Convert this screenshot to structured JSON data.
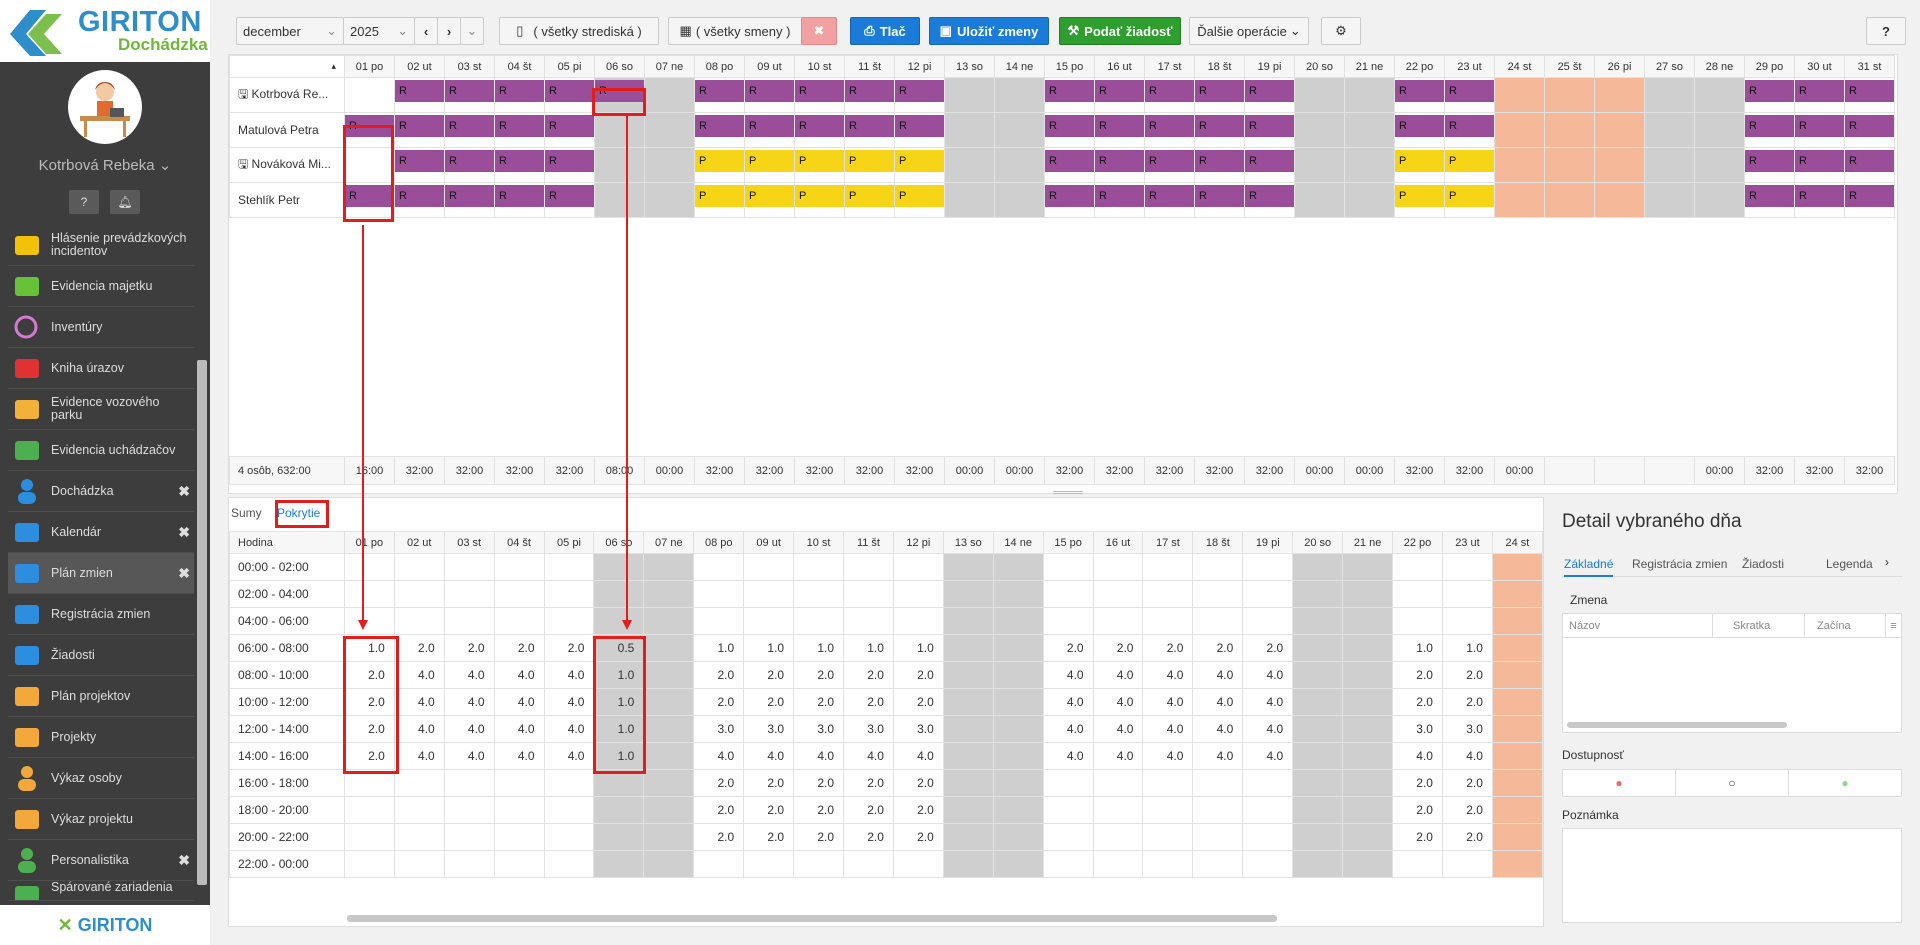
{
  "brand": {
    "name": "GIRITON",
    "sub": "Dochádzka",
    "footer": "GIRITON"
  },
  "user": {
    "name": "Kotrbová Rebeka"
  },
  "menu": [
    {
      "label": "Hlásenie prevádzkových incidentov",
      "icon": "megaphone-icon",
      "color": "#f2c10a",
      "close": false
    },
    {
      "label": "Evidencia majetku",
      "icon": "box-icon",
      "color": "#67c23a",
      "close": false
    },
    {
      "label": "Inventúry",
      "icon": "circle-icon",
      "color": "#d27bd2",
      "close": false
    },
    {
      "label": "Kniha úrazov",
      "icon": "ambulance-icon",
      "color": "#e03232",
      "close": false
    },
    {
      "label": "Evidence vozového parku",
      "icon": "car-icon",
      "color": "#f2b23a",
      "close": false
    },
    {
      "label": "Evidencia uchádzačov",
      "icon": "user-plus-icon",
      "color": "#4caf50",
      "close": false
    },
    {
      "label": "Dochádzka",
      "icon": "user-icon",
      "color": "#2d8ee0",
      "close": true
    },
    {
      "label": "Kalendár",
      "icon": "calendar-icon",
      "color": "#2d8ee0",
      "close": true
    },
    {
      "label": "Plán zmien",
      "icon": "calendar-grid-icon",
      "color": "#2d8ee0",
      "close": true
    },
    {
      "label": "Registrácia zmien",
      "icon": "calendar-check-icon",
      "color": "#2d8ee0",
      "close": false
    },
    {
      "label": "Žiadosti",
      "icon": "gavel-icon",
      "color": "#2d8ee0",
      "close": false
    },
    {
      "label": "Plán projektov",
      "icon": "calendar-grid-icon",
      "color": "#f2a83a",
      "close": false
    },
    {
      "label": "Projekty",
      "icon": "calendar-icon",
      "color": "#f2a83a",
      "close": false
    },
    {
      "label": "Výkaz osoby",
      "icon": "user-icon",
      "color": "#f2a83a",
      "close": false
    },
    {
      "label": "Výkaz projektu",
      "icon": "users-icon",
      "color": "#f2a83a",
      "close": false
    },
    {
      "label": "Personalistika",
      "icon": "person-icon",
      "color": "#4caf50",
      "close": true
    },
    {
      "label": "Spárované zariadenia",
      "icon": "device-icon",
      "color": "#4caf50",
      "close": false
    }
  ],
  "toolbar": {
    "month": "december",
    "year": "2025",
    "centers": "( všetky strediská )",
    "shifts": "( všetky smeny )",
    "print": "Tlač",
    "save": "Uložiť zmeny",
    "request": "Podať žiadosť",
    "more": "Ďalšie operácie",
    "help": "?"
  },
  "days": [
    "01 po",
    "02 ut",
    "03 st",
    "04 št",
    "05 pi",
    "06 so",
    "07 ne",
    "08 po",
    "09 ut",
    "10 st",
    "11 št",
    "12 pi",
    "13 so",
    "14 ne",
    "15 po",
    "16 ut",
    "17 st",
    "18 št",
    "19 pi",
    "20 so",
    "21 ne",
    "22 po",
    "23 ut",
    "24 st",
    "25 št",
    "26 pi",
    "27 so",
    "28 ne",
    "29 po",
    "30 ut",
    "31 st"
  ],
  "employees": [
    {
      "name": "Kotrbová Re...",
      "icon": true,
      "shifts": [
        "",
        "R",
        "R",
        "R",
        "R",
        "R",
        "",
        "R",
        "R",
        "R",
        "R",
        "R",
        "",
        "",
        "R",
        "R",
        "R",
        "R",
        "R",
        "",
        "",
        "R",
        "R",
        "",
        "",
        "",
        "",
        "",
        "R",
        "R",
        "R"
      ]
    },
    {
      "name": "Matulová Petra",
      "icon": false,
      "shifts": [
        "R",
        "R",
        "R",
        "R",
        "R",
        "",
        "",
        "R",
        "R",
        "R",
        "R",
        "R",
        "",
        "",
        "R",
        "R",
        "R",
        "R",
        "R",
        "",
        "",
        "R",
        "R",
        "",
        "",
        "",
        "",
        "",
        "R",
        "R",
        "R"
      ]
    },
    {
      "name": "Nováková Mi...",
      "icon": true,
      "shifts": [
        "",
        "R",
        "R",
        "R",
        "R",
        "",
        "",
        "P",
        "P",
        "P",
        "P",
        "P",
        "",
        "",
        "R",
        "R",
        "R",
        "R",
        "R",
        "",
        "",
        "P",
        "P",
        "",
        "",
        "",
        "",
        "",
        "R",
        "R",
        "R"
      ]
    },
    {
      "name": "Stehlík Petr",
      "icon": false,
      "shifts": [
        "R",
        "R",
        "R",
        "R",
        "R",
        "",
        "",
        "P",
        "P",
        "P",
        "P",
        "P",
        "",
        "",
        "R",
        "R",
        "R",
        "R",
        "R",
        "",
        "",
        "P",
        "P",
        "",
        "",
        "",
        "",
        "",
        "R",
        "R",
        "R"
      ]
    }
  ],
  "summary": {
    "label": "4 osôb, 632:00",
    "totals": [
      "16:00",
      "32:00",
      "32:00",
      "32:00",
      "32:00",
      "08:00",
      "00:00",
      "32:00",
      "32:00",
      "32:00",
      "32:00",
      "32:00",
      "00:00",
      "00:00",
      "32:00",
      "32:00",
      "32:00",
      "32:00",
      "32:00",
      "00:00",
      "00:00",
      "32:00",
      "32:00",
      "00:00",
      "",
      "",
      "",
      "00:00",
      "32:00",
      "32:00",
      "32:00"
    ]
  },
  "coverage_tabs": {
    "sums": "Sumy",
    "coverage": "Pokrytie"
  },
  "coverage": {
    "hour_header": "Hodina",
    "days": [
      "01 po",
      "02 ut",
      "03 st",
      "04 št",
      "05 pi",
      "06 so",
      "07 ne",
      "08 po",
      "09 ut",
      "10 st",
      "11 št",
      "12 pi",
      "13 so",
      "14 ne",
      "15 po",
      "16 ut",
      "17 st",
      "18 št",
      "19 pi",
      "20 so",
      "21 ne",
      "22 po",
      "23 ut",
      "24 st"
    ],
    "rows": [
      {
        "hour": "00:00 - 02:00",
        "v": [
          "",
          "",
          "",
          "",
          "",
          "",
          "",
          "",
          "",
          "",
          "",
          "",
          "",
          "",
          "",
          "",
          "",
          "",
          "",
          "",
          "",
          "",
          "",
          ""
        ]
      },
      {
        "hour": "02:00 - 04:00",
        "v": [
          "",
          "",
          "",
          "",
          "",
          "",
          "",
          "",
          "",
          "",
          "",
          "",
          "",
          "",
          "",
          "",
          "",
          "",
          "",
          "",
          "",
          "",
          "",
          ""
        ]
      },
      {
        "hour": "04:00 - 06:00",
        "v": [
          "",
          "",
          "",
          "",
          "",
          "",
          "",
          "",
          "",
          "",
          "",
          "",
          "",
          "",
          "",
          "",
          "",
          "",
          "",
          "",
          "",
          "",
          "",
          ""
        ]
      },
      {
        "hour": "06:00 - 08:00",
        "v": [
          "1.0",
          "2.0",
          "2.0",
          "2.0",
          "2.0",
          "0.5",
          "",
          "1.0",
          "1.0",
          "1.0",
          "1.0",
          "1.0",
          "",
          "",
          "2.0",
          "2.0",
          "2.0",
          "2.0",
          "2.0",
          "",
          "",
          "1.0",
          "1.0",
          ""
        ]
      },
      {
        "hour": "08:00 - 10:00",
        "v": [
          "2.0",
          "4.0",
          "4.0",
          "4.0",
          "4.0",
          "1.0",
          "",
          "2.0",
          "2.0",
          "2.0",
          "2.0",
          "2.0",
          "",
          "",
          "4.0",
          "4.0",
          "4.0",
          "4.0",
          "4.0",
          "",
          "",
          "2.0",
          "2.0",
          ""
        ]
      },
      {
        "hour": "10:00 - 12:00",
        "v": [
          "2.0",
          "4.0",
          "4.0",
          "4.0",
          "4.0",
          "1.0",
          "",
          "2.0",
          "2.0",
          "2.0",
          "2.0",
          "2.0",
          "",
          "",
          "4.0",
          "4.0",
          "4.0",
          "4.0",
          "4.0",
          "",
          "",
          "2.0",
          "2.0",
          ""
        ]
      },
      {
        "hour": "12:00 - 14:00",
        "v": [
          "2.0",
          "4.0",
          "4.0",
          "4.0",
          "4.0",
          "1.0",
          "",
          "3.0",
          "3.0",
          "3.0",
          "3.0",
          "3.0",
          "",
          "",
          "4.0",
          "4.0",
          "4.0",
          "4.0",
          "4.0",
          "",
          "",
          "3.0",
          "3.0",
          ""
        ]
      },
      {
        "hour": "14:00 - 16:00",
        "v": [
          "2.0",
          "4.0",
          "4.0",
          "4.0",
          "4.0",
          "1.0",
          "",
          "4.0",
          "4.0",
          "4.0",
          "4.0",
          "4.0",
          "",
          "",
          "4.0",
          "4.0",
          "4.0",
          "4.0",
          "4.0",
          "",
          "",
          "4.0",
          "4.0",
          ""
        ]
      },
      {
        "hour": "16:00 - 18:00",
        "v": [
          "",
          "",
          "",
          "",
          "",
          "",
          "",
          "2.0",
          "2.0",
          "2.0",
          "2.0",
          "2.0",
          "",
          "",
          "",
          "",
          "",
          "",
          "",
          "",
          "",
          "2.0",
          "2.0",
          ""
        ]
      },
      {
        "hour": "18:00 - 20:00",
        "v": [
          "",
          "",
          "",
          "",
          "",
          "",
          "",
          "2.0",
          "2.0",
          "2.0",
          "2.0",
          "2.0",
          "",
          "",
          "",
          "",
          "",
          "",
          "",
          "",
          "",
          "2.0",
          "2.0",
          ""
        ]
      },
      {
        "hour": "20:00 - 22:00",
        "v": [
          "",
          "",
          "",
          "",
          "",
          "",
          "",
          "2.0",
          "2.0",
          "2.0",
          "2.0",
          "2.0",
          "",
          "",
          "",
          "",
          "",
          "",
          "",
          "",
          "",
          "2.0",
          "2.0",
          ""
        ]
      },
      {
        "hour": "22:00 - 00:00",
        "v": [
          "",
          "",
          "",
          "",
          "",
          "",
          "",
          "",
          "",
          "",
          "",
          "",
          "",
          "",
          "",
          "",
          "",
          "",
          "",
          "",
          "",
          "",
          "",
          ""
        ]
      }
    ]
  },
  "detail": {
    "title": "Detail vybraného dňa",
    "tabs": [
      "Základné",
      "Registrácia zmien",
      "Žiadosti",
      "Legenda"
    ],
    "shift_label": "Zmena",
    "cols": [
      "Názov",
      "Skratka",
      "Začína"
    ],
    "availability": "Dostupnosť",
    "note": "Poznámka"
  },
  "colors": {
    "work": "#9a4e9a",
    "afternoon": "#f5d515",
    "weekend": "#cfcfcf",
    "holiday": "#f5b999",
    "highlight": "#e31c1c"
  }
}
